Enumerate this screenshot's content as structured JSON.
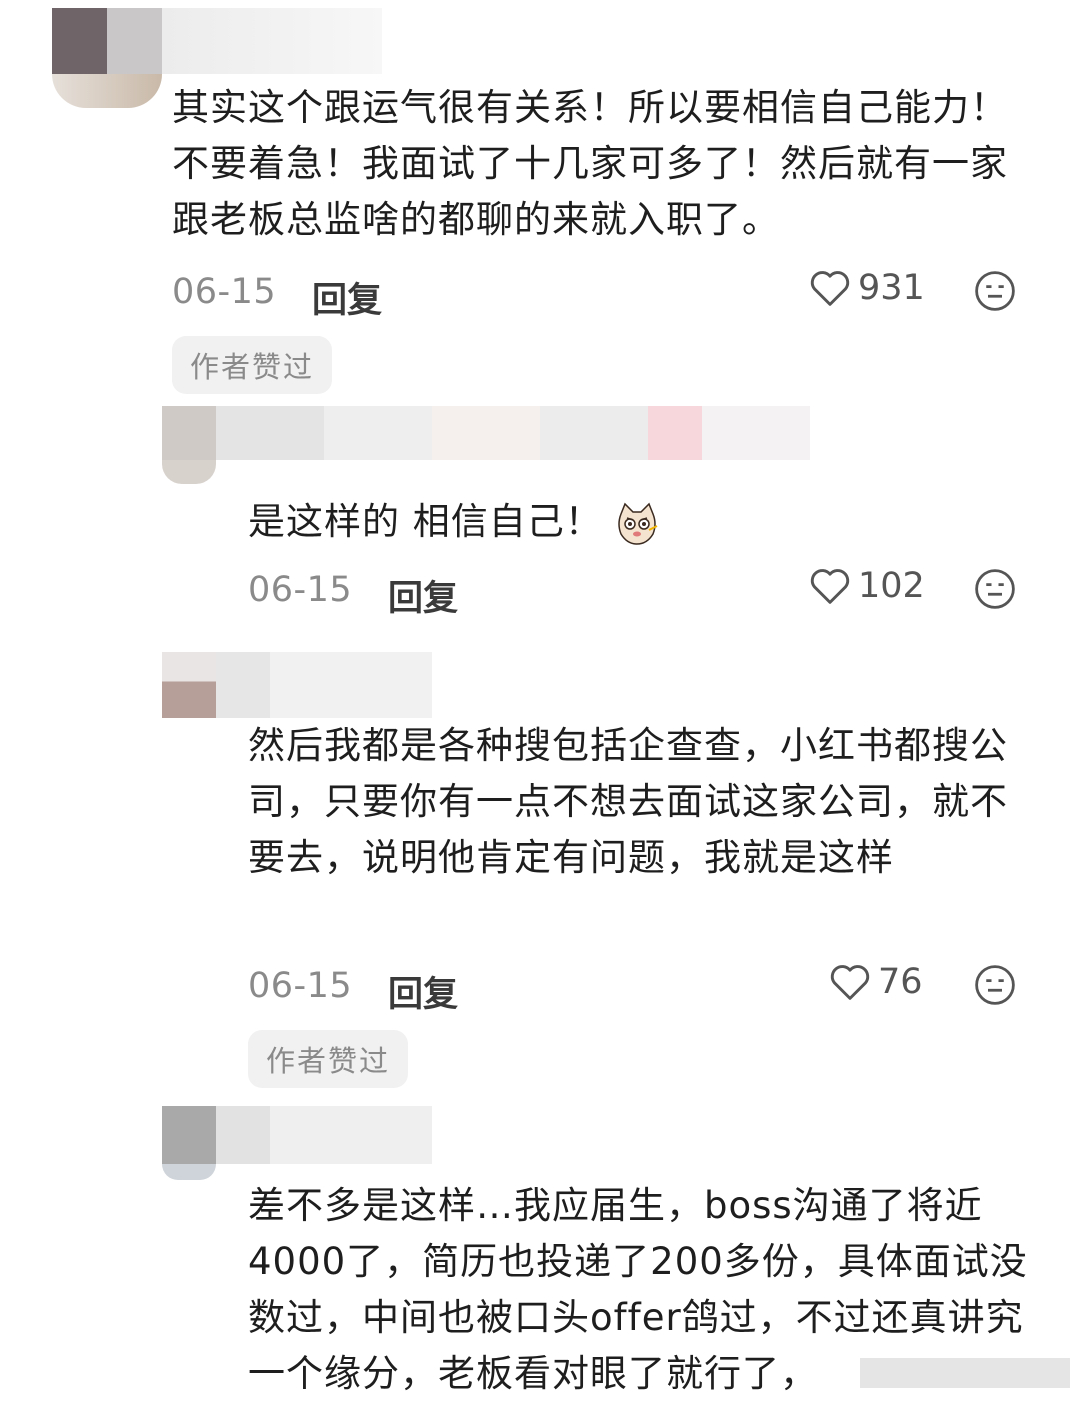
{
  "comments": [
    {
      "text": "其实这个跟运气很有关系！所以要相信自己能力！不要着急！我面试了十几家可多了！然后就有一家跟老板总监啥的都聊的来就入职了。",
      "date": "06-15",
      "reply_label": "回复",
      "likes": "931",
      "badge": "作者赞过"
    },
    {
      "text": "是这样的 相信自己！",
      "emoji": "cat-emoji",
      "date": "06-15",
      "reply_label": "回复",
      "likes": "102"
    },
    {
      "text": "然后我都是各种搜包括企查查，小红书都搜公司，只要你有一点不想去面试这家公司，就不要去，说明他肯定有问题，我就是这样",
      "date": "06-15",
      "reply_label": "回复",
      "likes": "76",
      "badge": "作者赞过"
    },
    {
      "text": "差不多是这样…我应届生，boss沟通了将近4000了，简历也投递了200多份，具体面试没数过，中间也被口头offer鸽过，不过还真讲究一个缘分，老板看对眼了就行了，"
    }
  ],
  "icons": {
    "like": "heart-icon",
    "dislike": "neutral-face-icon"
  },
  "colors": {
    "text": "#1e1e1e",
    "meta": "#8a8a8a",
    "badge_bg": "#f1f1f1"
  }
}
